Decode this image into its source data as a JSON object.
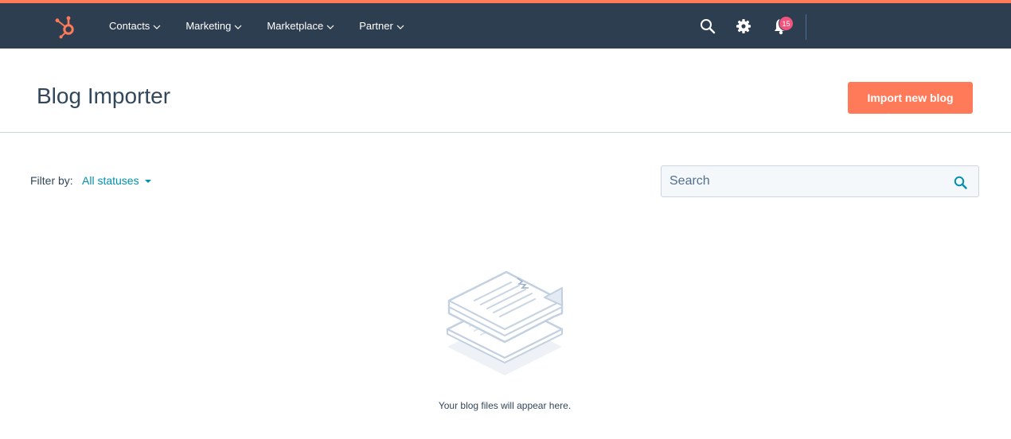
{
  "nav": {
    "items": [
      {
        "label": "Contacts"
      },
      {
        "label": "Marketing"
      },
      {
        "label": "Marketplace"
      },
      {
        "label": "Partner"
      }
    ],
    "notification_count": "15",
    "icons": [
      "hubspot-logo-icon",
      "search-icon",
      "gear-icon",
      "bell-icon"
    ]
  },
  "header": {
    "title": "Blog Importer",
    "import_button": "Import new blog"
  },
  "filter": {
    "label": "Filter by:",
    "selected": "All statuses"
  },
  "search": {
    "placeholder": "Search"
  },
  "empty_state": {
    "message": "Your blog files will appear here."
  },
  "colors": {
    "nav_bg": "#2d3e50",
    "accent": "#ff7a59",
    "link": "#0091ae",
    "badge": "#f2547d"
  }
}
